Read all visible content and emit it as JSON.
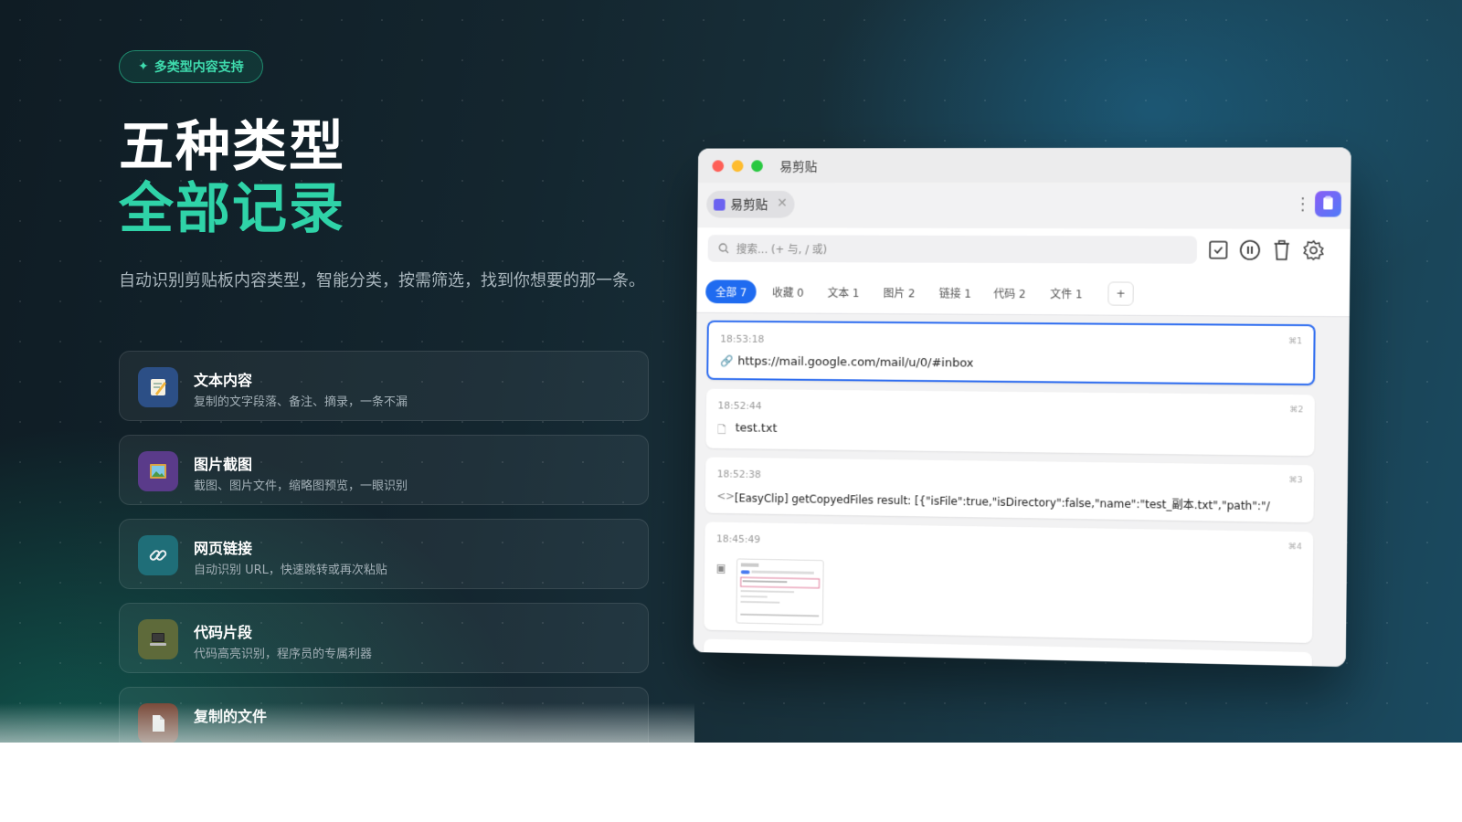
{
  "badge": {
    "icon": "sparkle-icon",
    "label": "多类型内容支持"
  },
  "headline": {
    "line1": "五种类型",
    "line2": "全部记录"
  },
  "subtitle": "自动识别剪贴板内容类型，智能分类，按需筛选，找到你想要的那一条。",
  "features": [
    {
      "icon": "memo-icon",
      "title": "文本内容",
      "desc": "复制的文字段落、备注、摘录，一条不漏"
    },
    {
      "icon": "picture-icon",
      "title": "图片截图",
      "desc": "截图、图片文件，缩略图预览，一眼识别"
    },
    {
      "icon": "link-icon",
      "title": "网页链接",
      "desc": "自动识别 URL，快速跳转或再次粘贴"
    },
    {
      "icon": "laptop-icon",
      "title": "代码片段",
      "desc": "代码高亮识别，程序员的专属利器"
    },
    {
      "icon": "file-icon",
      "title": "复制的文件",
      "desc": ""
    }
  ],
  "app": {
    "window_title": "易剪贴",
    "tab_label": "易剪贴",
    "search_placeholder": "搜索... (+ 与, / 或)",
    "filters": [
      {
        "label": "全部 7",
        "active": true
      },
      {
        "label": "收藏 0"
      },
      {
        "label": "文本 1"
      },
      {
        "label": "图片 2"
      },
      {
        "label": "链接 1"
      },
      {
        "label": "代码 2"
      },
      {
        "label": "文件 1"
      },
      {
        "label": "+"
      }
    ],
    "items": [
      {
        "time": "18:53:18",
        "num": "⌘1",
        "type": "link",
        "text": "https://mail.google.com/mail/u/0/#inbox"
      },
      {
        "time": "18:52:44",
        "num": "⌘2",
        "type": "file",
        "text": "test.txt"
      },
      {
        "time": "18:52:38",
        "num": "⌘3",
        "type": "code",
        "text": "[EasyClip] getCopyedFiles result: [{\"isFile\":true,\"isDirectory\":false,\"name\":\"test_副本.txt\",\"path\":\"/"
      },
      {
        "time": "18:45:49",
        "num": "⌘4",
        "type": "image",
        "text": ""
      }
    ]
  },
  "colors": {
    "accent": "#2fd3a8",
    "selected": "#2d6cf0"
  }
}
